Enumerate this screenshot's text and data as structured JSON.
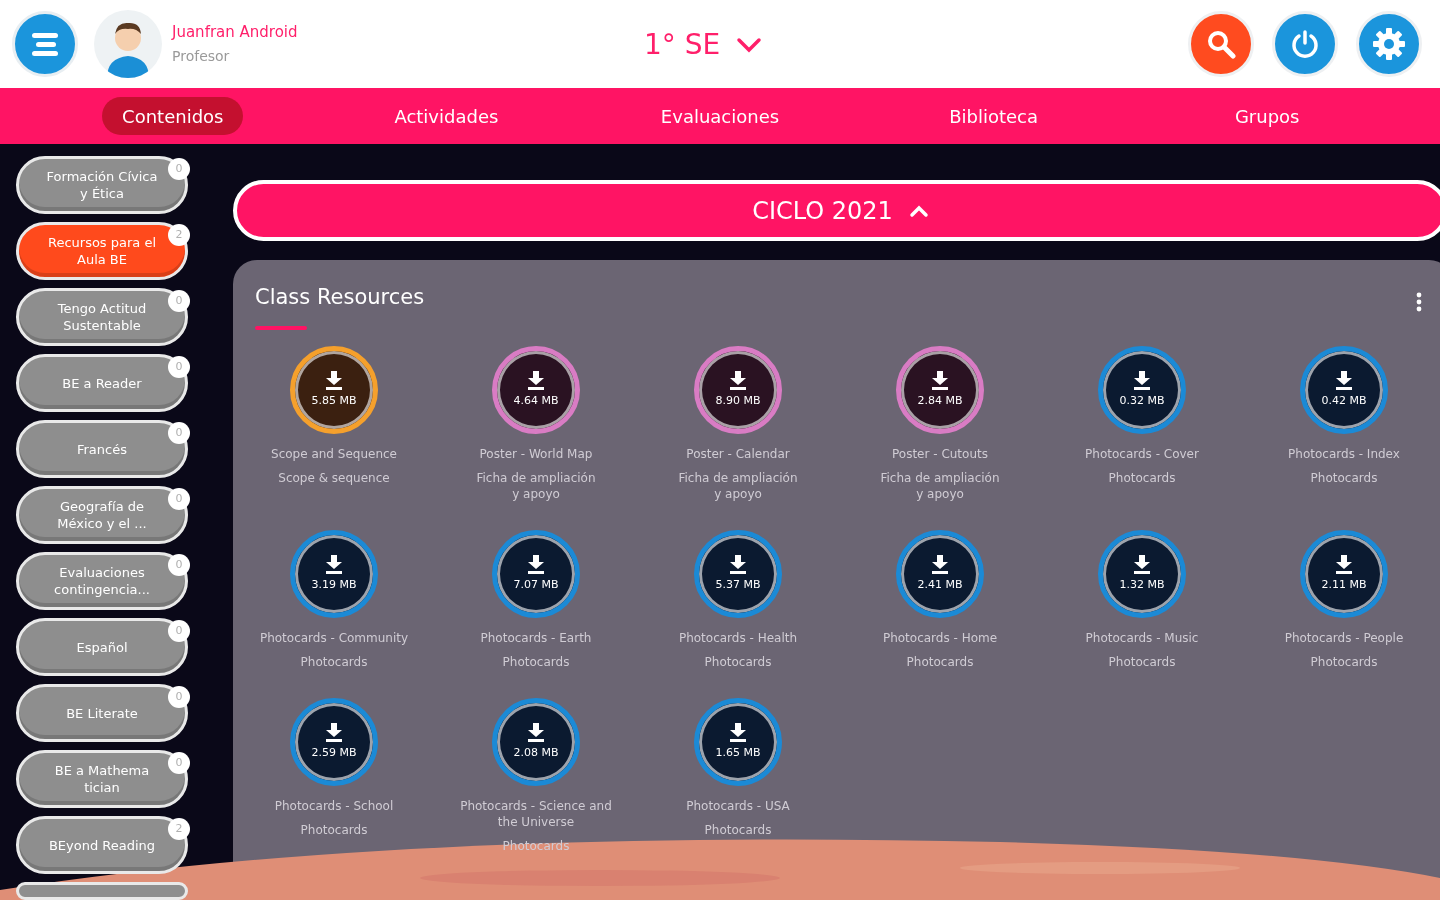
{
  "user": {
    "name": "Juanfran Android",
    "role": "Profesor"
  },
  "group": {
    "label": "1° SE"
  },
  "tabs": [
    {
      "label": "Contenidos",
      "selected": true
    },
    {
      "label": "Actividades",
      "selected": false
    },
    {
      "label": "Evaluaciones",
      "selected": false
    },
    {
      "label": "Biblioteca",
      "selected": false
    },
    {
      "label": "Grupos",
      "selected": false
    }
  ],
  "sidebar": {
    "items": [
      {
        "label": "Formación Cívica y Ética",
        "count": "0",
        "selected": false
      },
      {
        "label": "Recursos para el Aula BE",
        "count": "2",
        "selected": true
      },
      {
        "label": "Tengo Actitud Sustentable",
        "count": "0",
        "selected": false
      },
      {
        "label": "BE a Reader",
        "count": "0",
        "selected": false
      },
      {
        "label": "Francés",
        "count": "0",
        "selected": false
      },
      {
        "label": "Geografía de México y el ...",
        "count": "0",
        "selected": false
      },
      {
        "label": "Evaluaciones contingencia...",
        "count": "0",
        "selected": false
      },
      {
        "label": "Español",
        "count": "0",
        "selected": false
      },
      {
        "label": "BE Literate",
        "count": "0",
        "selected": false
      },
      {
        "label": "BE a Mathema tician",
        "count": "0",
        "selected": false
      },
      {
        "label": "BEyond Reading",
        "count": "2",
        "selected": false
      }
    ]
  },
  "cycle": {
    "label": "CICLO 2021",
    "expanded": true
  },
  "card": {
    "title": "Class Resources",
    "resources": [
      {
        "size": "5.85 MB",
        "title": "Scope and Sequence",
        "subtitle": "Scope & sequence",
        "color": "#f5a02c"
      },
      {
        "size": "4.64 MB",
        "title": "Poster - World Map",
        "subtitle": "Ficha de ampliación y apoyo",
        "color": "#d97cc4"
      },
      {
        "size": "8.90 MB",
        "title": "Poster - Calendar",
        "subtitle": "Ficha de ampliación y apoyo",
        "color": "#d97cc4"
      },
      {
        "size": "2.84 MB",
        "title": "Poster - Cutouts",
        "subtitle": "Ficha de ampliación y apoyo",
        "color": "#d97cc4"
      },
      {
        "size": "0.32 MB",
        "title": "Photocards - Cover",
        "subtitle": "Photocards",
        "color": "#1b8ad6"
      },
      {
        "size": "0.42 MB",
        "title": "Photocards - Index",
        "subtitle": "Photocards",
        "color": "#1b8ad6"
      },
      {
        "size": "3.19 MB",
        "title": "Photocards - Community",
        "subtitle": "Photocards",
        "color": "#1b8ad6"
      },
      {
        "size": "7.07 MB",
        "title": "Photocards - Earth",
        "subtitle": "Photocards",
        "color": "#1b8ad6"
      },
      {
        "size": "5.37 MB",
        "title": "Photocards - Health",
        "subtitle": "Photocards",
        "color": "#1b8ad6"
      },
      {
        "size": "2.41 MB",
        "title": "Photocards - Home",
        "subtitle": "Photocards",
        "color": "#1b8ad6"
      },
      {
        "size": "1.32 MB",
        "title": "Photocards - Music",
        "subtitle": "Photocards",
        "color": "#1b8ad6"
      },
      {
        "size": "2.11 MB",
        "title": "Photocards - People",
        "subtitle": "Photocards",
        "color": "#1b8ad6"
      },
      {
        "size": "2.59 MB",
        "title": "Photocards - School",
        "subtitle": "Photocards",
        "color": "#1b8ad6"
      },
      {
        "size": "2.08 MB",
        "title": "Photocards - Science and the Universe",
        "subtitle": "Photocards",
        "color": "#1b8ad6"
      },
      {
        "size": "1.65 MB",
        "title": "Photocards - USA",
        "subtitle": "Photocards",
        "color": "#1b8ad6"
      }
    ]
  }
}
